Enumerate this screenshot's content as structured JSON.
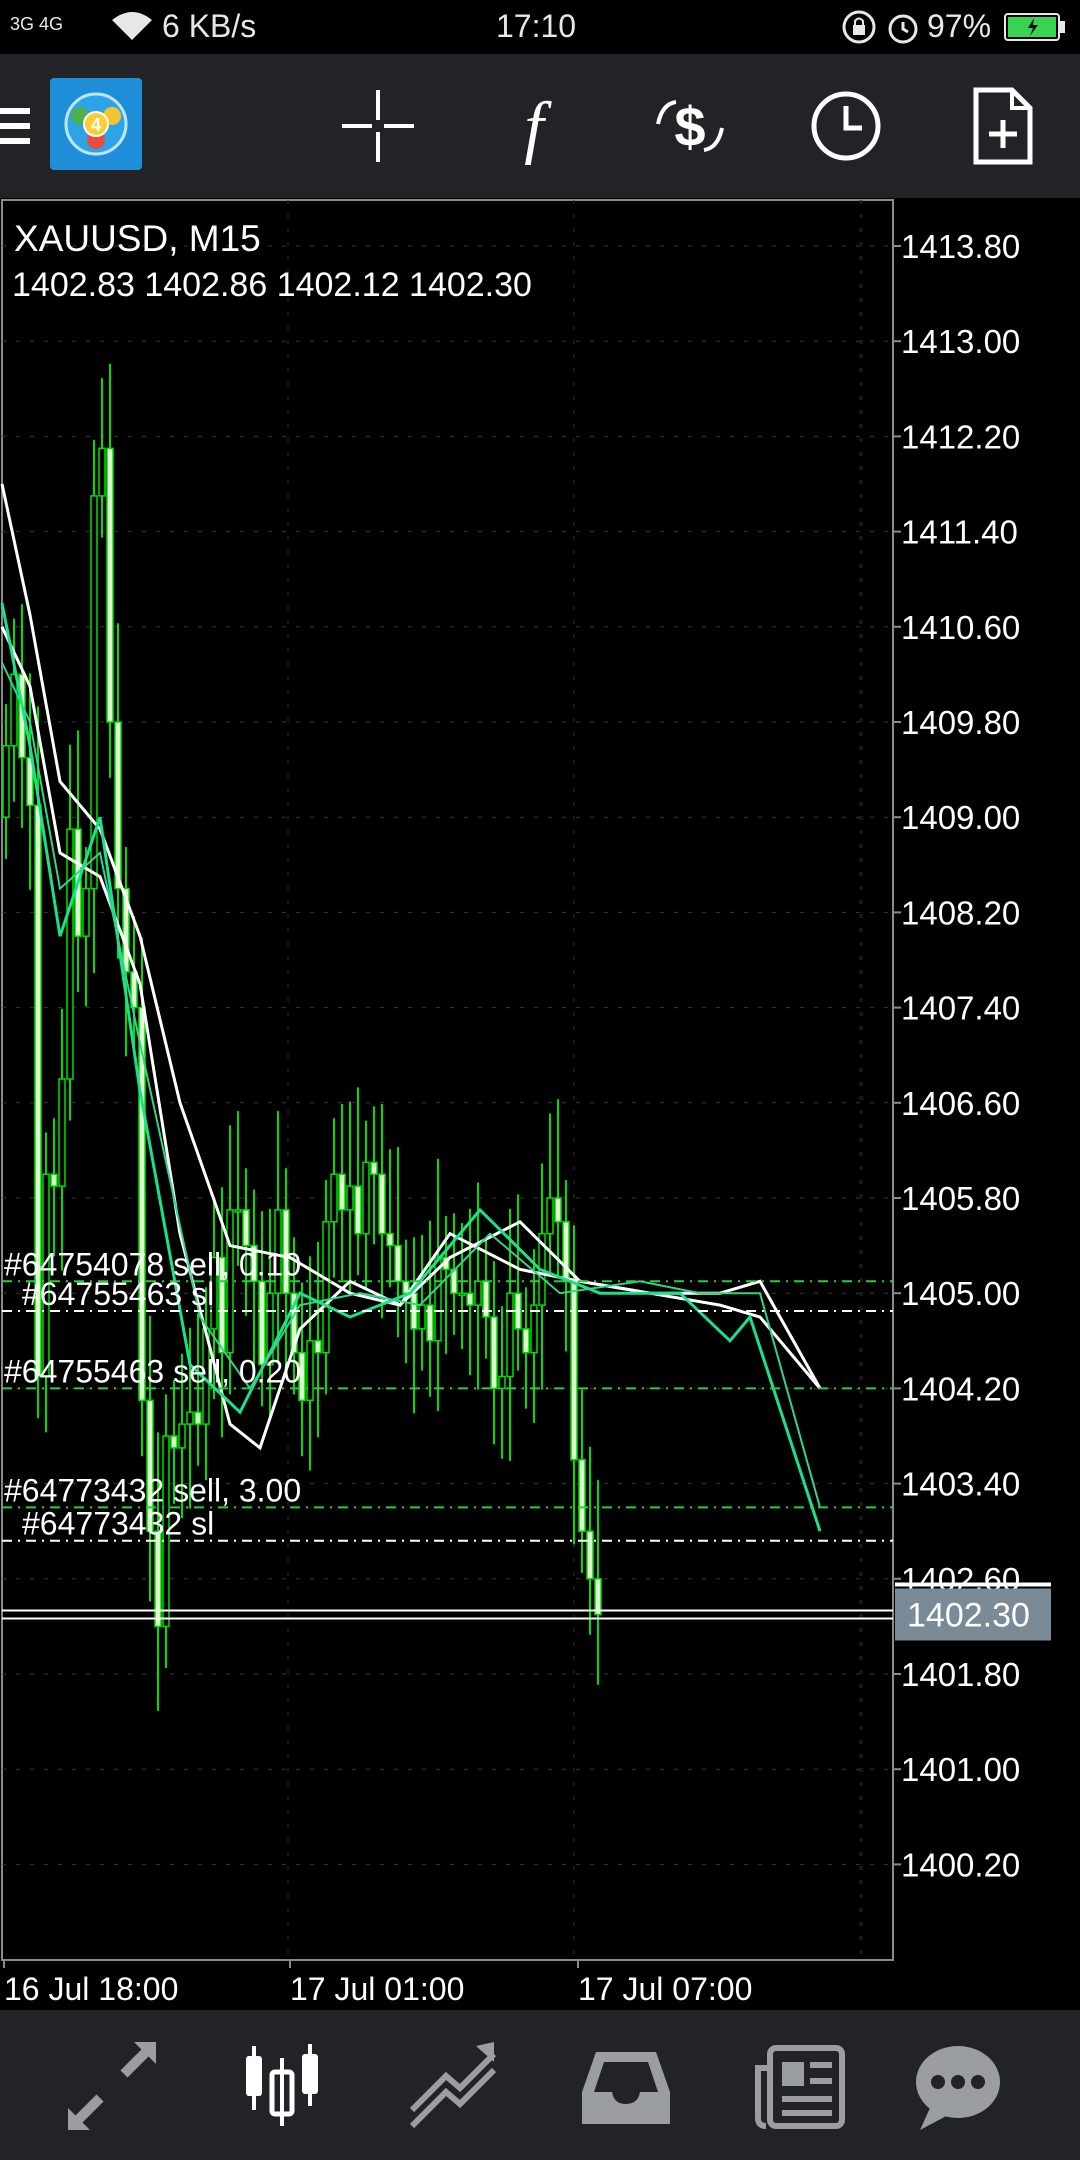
{
  "status_bar": {
    "network": "3G 4G",
    "speed": "6 KB/s",
    "time": "17:10",
    "battery_pct": "97%",
    "battery_color": "#39d353"
  },
  "toolbar": {
    "background": "#212326",
    "icons": [
      "menu-icon",
      "metatrader-logo",
      "crosshair-icon",
      "function-icon",
      "trade-dollar-icon",
      "clock-icon",
      "new-document-icon"
    ]
  },
  "chart": {
    "symbol": "XAUUSD, M15",
    "ohlc": "1402.83 1402.86 1402.12 1402.30",
    "price_labels": [
      "1413.80",
      "1413.00",
      "1412.20",
      "1411.40",
      "1410.60",
      "1409.80",
      "1409.00",
      "1408.20",
      "1407.40",
      "1406.60",
      "1405.80",
      "1405.00",
      "1404.20",
      "1403.40",
      "1402.60",
      "1401.80",
      "1401.00",
      "1400.20"
    ],
    "current_price": "1402.30",
    "time_labels": [
      "16 Jul 18:00",
      "17 Jul 01:00",
      "17 Jul 07:00"
    ],
    "order_labels": [
      "#64754078 sell, 0.10",
      "#64755463 sl",
      "#64755463 sell, 0.20",
      "#64773432 sell, 3.00",
      "#64773432 sl"
    ],
    "colors": {
      "bull": "#00e000",
      "bear_body": "#dfffd0",
      "ma_white": "#ffffff",
      "ma_green": "#18e28c",
      "order_line": "#2ecc40",
      "sl_line": "#ffffff",
      "bid_label_bg": "#7a8a96"
    }
  },
  "bottom_nav": {
    "items": [
      "quotes-icon",
      "chart-icon",
      "trade-icon",
      "history-icon",
      "news-icon",
      "messages-icon"
    ],
    "active": "chart-icon"
  }
}
